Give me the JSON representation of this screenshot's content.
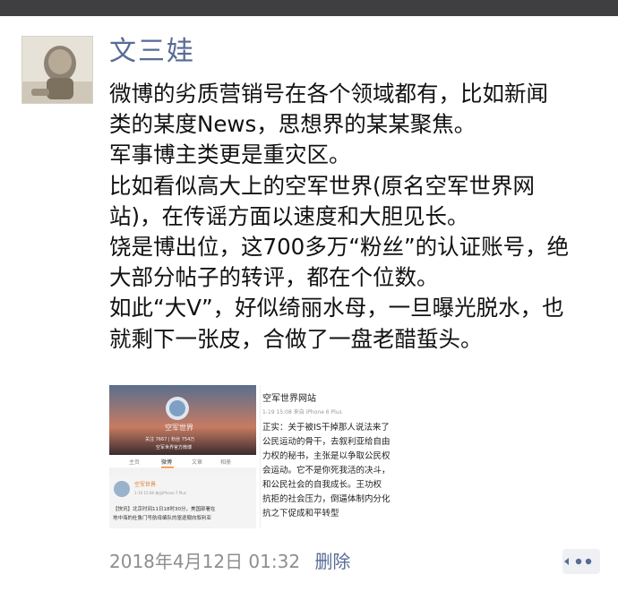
{
  "post": {
    "author": "文三娃",
    "content_lines": [
      "微博的劣质营销号在各个领域都有，比如新闻",
      "类的某度News，思想界的某某聚焦。",
      "军事博主类更是重灾区。",
      "比如看似高大上的空军世界(原名空军世界网",
      "站)，在传谣方面以速度和大胆见长。",
      "饶是博出位，这700多万“粉丝”的认证账号，绝",
      "大部分帖子的转评，都在个位数。",
      "如此“大V”，好似绮丽水母，一旦曝光脱水，也",
      "就剩下一张皮，合做了一盘老醋蜇头。"
    ],
    "timestamp": "2018年4月12日 01:32",
    "delete_label": "删除"
  },
  "images": {
    "img1": {
      "stats": "关注 7667  |  粉丝 754万",
      "verify": "空军世界官方微博",
      "tabs": [
        "主页",
        "微博",
        "文章",
        "相册"
      ],
      "post_name": "空军世界",
      "post_meta": "1-19 15:08  来自iPhone 7 Plus",
      "post_text_1": "【快讯】北京时间11日18时30分，美国部署在",
      "post_text_2": "地中海的杜鲁门号航母编队的驱逐舰向叙利亚"
    },
    "img2": {
      "title": "空军世界网站",
      "meta": "1-19 15:08  来自 iPhone 6 Plus",
      "text_lines": [
        "正实：关于被IS干掉那人说法来了",
        "公民运动的骨干，去叙利亚给自由",
        "力权的秘书，主张是以争取公民权",
        "会运动。它不是你死我活的决斗，",
        "和公民社会的自我成长。王功权",
        "抗拒的社会压力，倒逼体制内分化",
        "抗之下促成和平转型"
      ]
    }
  },
  "colors": {
    "name": "#576b95",
    "text": "#111111",
    "meta": "#8e8e8e",
    "topbar": "#3f3f41"
  },
  "icons": {
    "comment": "comment-dots-icon"
  }
}
